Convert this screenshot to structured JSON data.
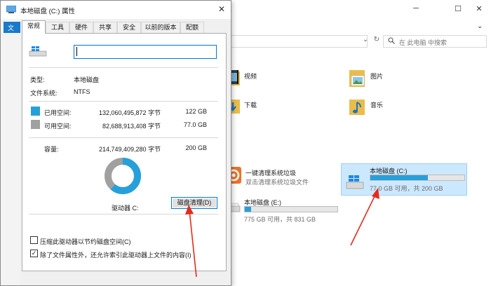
{
  "explorer": {
    "left_tab": "文",
    "search_placeholder": "在 此电脑 中搜索",
    "folders": [
      {
        "label": "视频"
      },
      {
        "label": "图片"
      },
      {
        "label": "下载"
      },
      {
        "label": "音乐"
      }
    ],
    "apps": [
      {
        "title": "一键清理系统垃圾",
        "subtitle": "双击清理系统垃圾文件"
      }
    ],
    "drives": [
      {
        "name": "本地磁盘 (C:)",
        "free_text": "77.0 GB 可用，共 200 GB",
        "used_fraction": 0.615,
        "selected": true
      },
      {
        "name": "本地磁盘 (E:)",
        "free_text": "775 GB 可用，共 831 GB",
        "used_fraction": 0.067,
        "selected": false
      }
    ]
  },
  "dialog": {
    "title": "本地磁盘 (C:) 属性",
    "tabs": [
      "常规",
      "工具",
      "硬件",
      "共享",
      "安全",
      "以前的版本",
      "配额"
    ],
    "active_tab": "常规",
    "name_value": "",
    "type_label": "类型:",
    "type_value": "本地磁盘",
    "fs_label": "文件系统:",
    "fs_value": "NTFS",
    "used_label": "已用空间:",
    "used_bytes": "132,060,495,872 字节",
    "used_size": "122 GB",
    "free_label": "可用空间:",
    "free_bytes": "82,688,913,408 字节",
    "free_size": "77.0 GB",
    "cap_label": "容量:",
    "cap_bytes": "214,749,409,280 字节",
    "cap_size": "200 GB",
    "used_fraction": 0.615,
    "drive_label": "驱动器 C:",
    "cleanup_button": "磁盘清理(D)",
    "compress_label": "压缩此驱动器以节约磁盘空间(C)",
    "compress_checked": false,
    "index_label": "除了文件属性外，还允许索引此驱动器上文件的内容(I)",
    "index_checked": true,
    "colors": {
      "used": "#26a0da",
      "free": "#a0a0a0",
      "accent": "#0078d7",
      "arrow": "#e52b1c"
    }
  }
}
